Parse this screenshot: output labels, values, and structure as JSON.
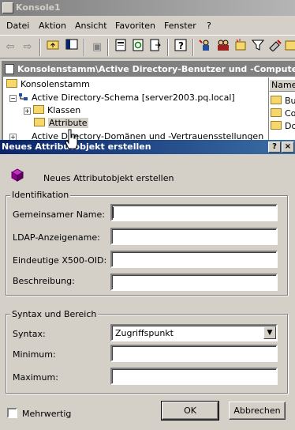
{
  "window": {
    "title": "Konsole1"
  },
  "menu": [
    {
      "label": "Datei"
    },
    {
      "label": "Aktion"
    },
    {
      "label": "Ansicht"
    },
    {
      "label": "Favoriten"
    },
    {
      "label": "Fenster"
    },
    {
      "label": "?"
    }
  ],
  "toolbar": {
    "icons": [
      "back-icon",
      "forward-icon",
      "up-folder-icon",
      "show-tree-icon",
      "delete-icon",
      "properties-icon",
      "refresh-icon",
      "export-icon",
      "help-icon",
      "users-icon",
      "groups-icon",
      "new-icon",
      "filter-icon",
      "find-icon",
      "add-icon"
    ]
  },
  "inner_window": {
    "title": "Konsolenstamm\\Active Directory-Benutzer und -Computer [se"
  },
  "tree": [
    {
      "label": "Konsolenstamm"
    },
    {
      "label": "Active Directory-Schema [server2003.pq.local]"
    },
    {
      "label": "Klassen"
    },
    {
      "label": "Attribute"
    },
    {
      "label": "Active Directory-Domänen und -Vertrauensstellungen"
    }
  ],
  "right_pane": {
    "header": "Name",
    "items": [
      "Bui",
      "Co",
      "Do"
    ]
  },
  "dialog": {
    "title": "Neues Attributobjekt erstellen",
    "intro": "Neues Attributobjekt erstellen",
    "help_button": "?",
    "close_button": "×",
    "identification": {
      "legend": "Identifikation",
      "common_name_label": "Gemeinsamer Name:",
      "common_name_value": "",
      "ldap_label": "LDAP-Anzeigename:",
      "ldap_value": "",
      "oid_label": "Eindeutige X500-OID:",
      "oid_value": "",
      "description_label": "Beschreibung:",
      "description_value": ""
    },
    "syntax": {
      "legend": "Syntax und Bereich",
      "syntax_label": "Syntax:",
      "syntax_value": "Zugriffspunkt",
      "minimum_label": "Minimum:",
      "minimum_value": "",
      "maximum_label": "Maximum:",
      "maximum_value": ""
    },
    "multivalued_label": "Mehrwertig",
    "multivalued_checked": false,
    "ok_label": "OK",
    "cancel_label": "Abbrechen"
  }
}
